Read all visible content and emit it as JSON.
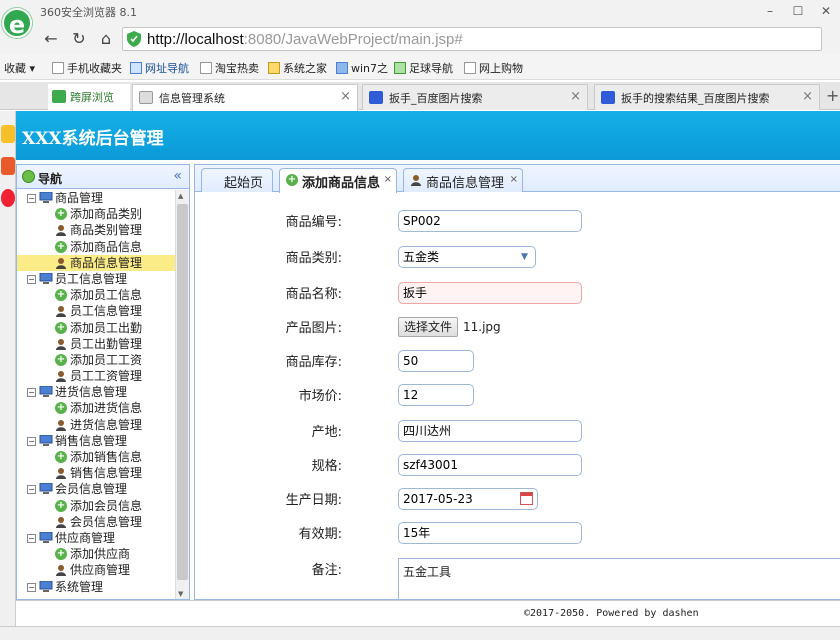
{
  "browser": {
    "title": "360安全浏览器 8.1",
    "url_host": "http://localhost",
    "url_rest": ":8080/JavaWebProject/main.jsp#",
    "bookmarks": [
      "收藏",
      "手机收藏夹",
      "网址导航",
      "淘宝热卖",
      "系统之家",
      "win7之",
      "足球导航",
      "网上购物"
    ],
    "tabs": [
      {
        "label": "跨屏浏览"
      },
      {
        "label": "信息管理系统"
      },
      {
        "label": "扳手_百度图片搜索"
      },
      {
        "label": "扳手的搜索结果_百度图片搜索"
      }
    ],
    "new_tab": "+"
  },
  "app": {
    "title": "XXX系统后台管理"
  },
  "sidebar": {
    "title": "导航",
    "collapse": "«",
    "groups": [
      {
        "label": "商品管理",
        "children": [
          {
            "label": "添加商品类别",
            "icon": "add-icon"
          },
          {
            "label": "商品类别管理",
            "icon": "user-icon"
          },
          {
            "label": "添加商品信息",
            "icon": "add-icon"
          },
          {
            "label": "商品信息管理",
            "icon": "user-icon"
          }
        ]
      },
      {
        "label": "员工信息管理",
        "children": [
          {
            "label": "添加员工信息",
            "icon": "add-icon"
          },
          {
            "label": "员工信息管理",
            "icon": "user-icon"
          },
          {
            "label": "添加员工出勤",
            "icon": "add-icon"
          },
          {
            "label": "员工出勤管理",
            "icon": "user-icon"
          },
          {
            "label": "添加员工工资",
            "icon": "add-icon"
          },
          {
            "label": "员工工资管理",
            "icon": "user-icon"
          }
        ]
      },
      {
        "label": "进货信息管理",
        "children": [
          {
            "label": "添加进货信息",
            "icon": "add-icon"
          },
          {
            "label": "进货信息管理",
            "icon": "user-icon"
          }
        ]
      },
      {
        "label": "销售信息管理",
        "children": [
          {
            "label": "添加销售信息",
            "icon": "add-icon"
          },
          {
            "label": "销售信息管理",
            "icon": "user-icon"
          }
        ]
      },
      {
        "label": "会员信息管理",
        "children": [
          {
            "label": "添加会员信息",
            "icon": "add-icon"
          },
          {
            "label": "会员信息管理",
            "icon": "user-icon"
          }
        ]
      },
      {
        "label": "供应商管理",
        "children": [
          {
            "label": "添加供应商",
            "icon": "add-icon"
          },
          {
            "label": "供应商管理",
            "icon": "user-icon"
          }
        ]
      },
      {
        "label": "系统管理",
        "children": []
      }
    ],
    "selected": "商品信息管理"
  },
  "tabs": {
    "home": "起始页",
    "add_product": "添加商品信息",
    "product_manage": "商品信息管理",
    "close": "×"
  },
  "form": {
    "product_no": {
      "label": "商品编号:",
      "value": "SP002"
    },
    "category": {
      "label": "商品类别:",
      "value": "五金类"
    },
    "name": {
      "label": "商品名称:",
      "value": "扳手"
    },
    "image": {
      "label": "产品图片:",
      "button": "选择文件",
      "file": "11.jpg"
    },
    "stock": {
      "label": "商品库存:",
      "value": "50"
    },
    "price": {
      "label": "市场价:",
      "value": "12"
    },
    "origin": {
      "label": "产地:",
      "value": "四川达州"
    },
    "spec": {
      "label": "规格:",
      "value": "szf43001"
    },
    "date": {
      "label": "生产日期:",
      "value": "2017-05-23"
    },
    "validity": {
      "label": "有效期:",
      "value": "15年"
    },
    "remark": {
      "label": "备注:",
      "value": "五金工具"
    }
  },
  "footer": {
    "copyright": "©2017-2050. Powered by dashen"
  },
  "colors": {
    "header": "#0a9ad8",
    "panel_border": "#95b8e7",
    "selected": "#fbec88"
  }
}
